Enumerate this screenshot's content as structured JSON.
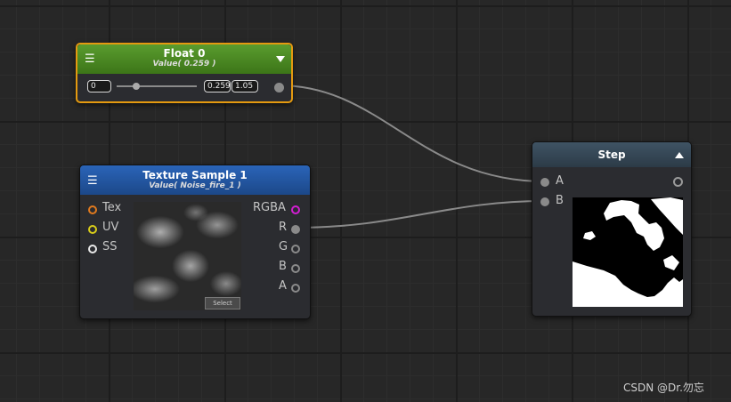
{
  "float_node": {
    "title": "Float 0",
    "subtitle": "Value( 0.259 )",
    "min_value": "0",
    "value": "0.259",
    "max_value": "1.05",
    "slider_fraction": 0.247
  },
  "texture_node": {
    "title": "Texture Sample 1",
    "subtitle": "Value( Noise_fire_1 )",
    "inputs": [
      "Tex",
      "UV",
      "SS"
    ],
    "outputs": [
      "RGBA",
      "R",
      "G",
      "B",
      "A"
    ],
    "select_label": "Select"
  },
  "step_node": {
    "title": "Step",
    "inputs": [
      "A",
      "B"
    ]
  },
  "colors": {
    "float_header": "#4b8b24",
    "float_border": "#e49a10",
    "texture_header": "#2459a8",
    "step_header": "#3a4c5c",
    "port_tex": "#e07a1e",
    "port_uv": "#d8cc1a",
    "port_ss": "#e8e8e8",
    "port_rgba": "#d21ed2",
    "wire": "#8a8a8a"
  },
  "icons": {
    "menu": "hamburger-icon",
    "float_collapse": "triangle-down-icon",
    "step_collapse": "triangle-up-icon"
  },
  "watermark": "CSDN @Dr.勿忘"
}
